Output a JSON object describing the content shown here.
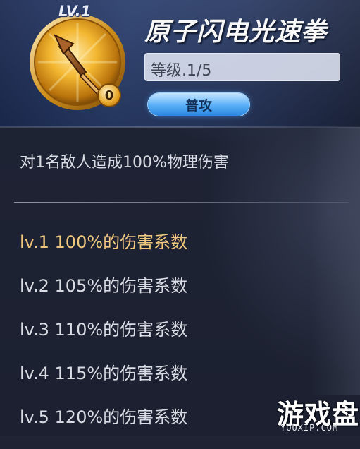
{
  "skill": {
    "level_badge": "LV.1",
    "name": "原子闪电光速拳",
    "level_text": "等级.1/5",
    "type_tag": "普攻",
    "points": "0",
    "icon": "spearhead-icon"
  },
  "description": "对1名敌人造成100%物理伤害",
  "levels": [
    {
      "label": "lv.1 100%的伤害系数",
      "active": true
    },
    {
      "label": "lv.2 105%的伤害系数",
      "active": false
    },
    {
      "label": "lv.3 110%的伤害系数",
      "active": false
    },
    {
      "label": "lv.4 115%的伤害系数",
      "active": false
    },
    {
      "label": "lv.5 120%的伤害系数",
      "active": false
    }
  ],
  "watermark": {
    "cn": "游戏盘",
    "en": "YOUXIP.COM"
  },
  "colors": {
    "panel_bg": "#1f2334",
    "active_level": "#f0c77e",
    "inactive_level": "#d9dce4",
    "tag_blue": "#58aff7",
    "medal_gold": "#e6a423"
  }
}
